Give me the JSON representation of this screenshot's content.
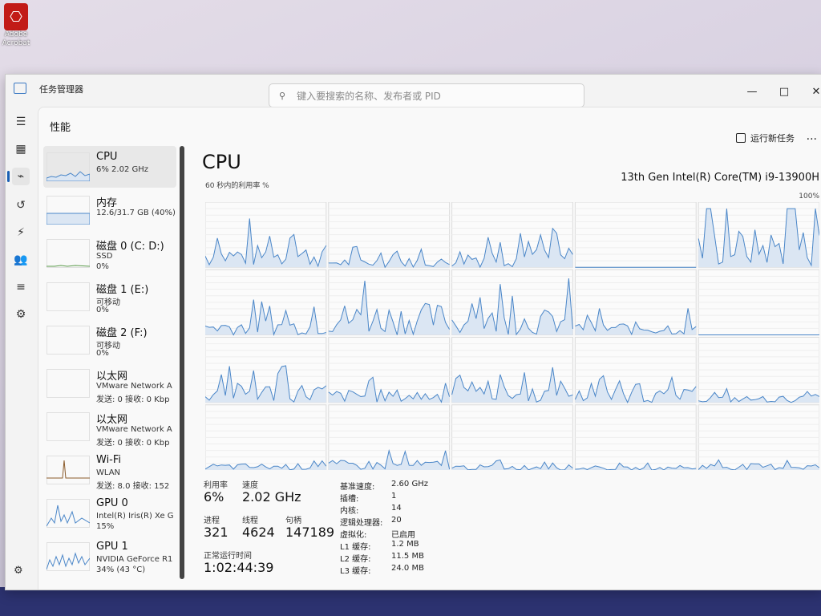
{
  "desktop": {
    "icon_label_1": "Adobe",
    "icon_label_2": "Acrobat"
  },
  "window": {
    "title": "任务管理器",
    "search_placeholder": "键入要搜索的名称、发布者或 PID",
    "controls": [
      "—",
      "□",
      "✕"
    ]
  },
  "page": {
    "title": "性能",
    "run_new_task": "运行新任务",
    "more": "..."
  },
  "sidebar": {
    "items": [
      {
        "name": "CPU",
        "sub1": "6% 2.02 GHz",
        "sub2": ""
      },
      {
        "name": "内存",
        "sub1": "12.6/31.7 GB (40%)",
        "sub2": ""
      },
      {
        "name": "磁盘 0 (C: D:)",
        "sub1": "SSD",
        "sub2": "0%"
      },
      {
        "name": "磁盘 1 (E:)",
        "sub1": "可移动",
        "sub2": "0%"
      },
      {
        "name": "磁盘 2 (F:)",
        "sub1": "可移动",
        "sub2": "0%"
      },
      {
        "name": "以太网",
        "sub1": "VMware Network A",
        "sub2": "发送: 0 接收: 0 Kbp"
      },
      {
        "name": "以太网",
        "sub1": "VMware Network A",
        "sub2": "发送: 0 接收: 0 Kbp"
      },
      {
        "name": "Wi-Fi",
        "sub1": "WLAN",
        "sub2": "发送: 8.0 接收: 152"
      },
      {
        "name": "GPU 0",
        "sub1": "Intel(R) Iris(R) Xe G",
        "sub2": "15%"
      },
      {
        "name": "GPU 1",
        "sub1": "NVIDIA GeForce R1",
        "sub2": "34% (43 °C)"
      }
    ]
  },
  "cpu": {
    "title": "CPU",
    "model": "13th Gen Intel(R) Core(TM) i9-13900H",
    "util_label": "60 秒内的利用率 %",
    "pct_max": "100%",
    "stats": {
      "utilization_label": "利用率",
      "utilization": "6%",
      "speed_label": "速度",
      "speed": "2.02 GHz",
      "processes_label": "进程",
      "processes": "321",
      "threads_label": "线程",
      "threads": "4624",
      "handles_label": "句柄",
      "handles": "147189",
      "uptime_label": "正常运行时间",
      "uptime": "1:02:44:39"
    },
    "specs": [
      {
        "label": "基准速度:",
        "value": "2.60 GHz"
      },
      {
        "label": "插槽:",
        "value": "1"
      },
      {
        "label": "内核:",
        "value": "14"
      },
      {
        "label": "逻辑处理器:",
        "value": "20"
      },
      {
        "label": "虚拟化:",
        "value": "已启用"
      },
      {
        "label": "L1 缓存:",
        "value": "1.2 MB"
      },
      {
        "label": "L2 缓存:",
        "value": "11.5 MB"
      },
      {
        "label": "L3 缓存:",
        "value": "24.0 MB"
      }
    ]
  },
  "colors": {
    "accent": "#1a5fb4",
    "cpu_line": "#4a86c8",
    "cpu_fill": "#dbe6f3",
    "grid_line": "#dcdcdc"
  },
  "icons": [
    "hamburger-icon",
    "processes-icon",
    "performance-icon",
    "history-icon",
    "startup-icon",
    "users-icon",
    "details-icon",
    "services-icon",
    "settings-icon",
    "search-icon",
    "run-task-icon"
  ]
}
